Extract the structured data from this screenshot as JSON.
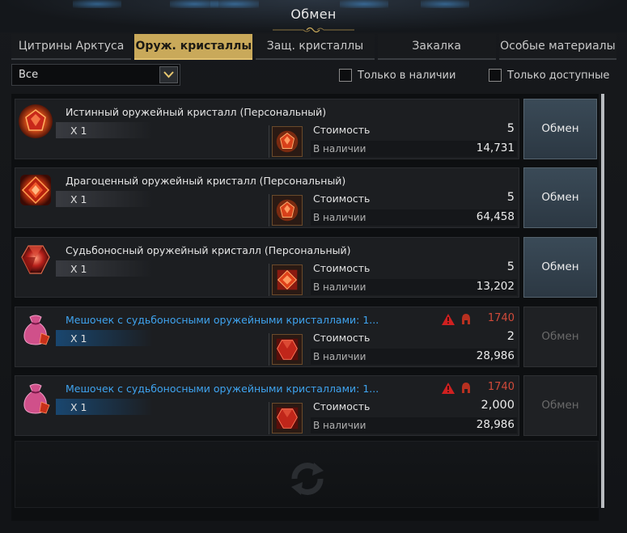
{
  "window": {
    "title": "Обмен"
  },
  "tabs": [
    {
      "label": "Цитрины Арктуса",
      "active": false
    },
    {
      "label": "Оруж. кристаллы",
      "active": true
    },
    {
      "label": "Защ. кристаллы",
      "active": false
    },
    {
      "label": "Закалка",
      "active": false
    },
    {
      "label": "Особые материалы",
      "active": false
    }
  ],
  "filters": {
    "category_value": "Все",
    "only_in_stock_label": "Только в наличии",
    "only_in_stock_checked": false,
    "only_available_label": "Только доступные",
    "only_available_checked": false
  },
  "labels": {
    "cost": "Стоимость",
    "in_stock": "В наличии",
    "exchange_button": "Обмен"
  },
  "items": [
    {
      "name": "Истинный оружейный кристалл (Персональный)",
      "quantity": "X 1",
      "cost": "5",
      "in_stock": "14,731",
      "icon": "true-weapon-crystal-icon",
      "cost_icon": "crystal-cost-icon",
      "is_bag": false,
      "level": "",
      "exchange_enabled": true
    },
    {
      "name": "Драгоценный оружейный кристалл (Персональный)",
      "quantity": "X 1",
      "cost": "5",
      "in_stock": "64,458",
      "icon": "precious-weapon-crystal-icon",
      "cost_icon": "crystal-cost-icon",
      "is_bag": false,
      "level": "",
      "exchange_enabled": true
    },
    {
      "name": "Судьбоносный оружейный кристалл (Персональный)",
      "quantity": "X 1",
      "cost": "5",
      "in_stock": "13,202",
      "icon": "fateful-weapon-crystal-icon",
      "cost_icon": "crystal-cost-icon",
      "is_bag": false,
      "level": "",
      "exchange_enabled": true
    },
    {
      "name": "Мешочек с судьбоносными оружейными кристаллами: 1...",
      "quantity": "X 1",
      "cost": "2",
      "in_stock": "28,986",
      "icon": "crystal-pouch-icon",
      "cost_icon": "red-crystal-cost-icon",
      "is_bag": true,
      "level": "1740",
      "exchange_enabled": false
    },
    {
      "name": "Мешочек с судьбоносными оружейными кристаллами: 1...",
      "quantity": "X 1",
      "cost": "2,000",
      "in_stock": "28,986",
      "icon": "crystal-pouch-icon",
      "cost_icon": "red-crystal-cost-icon",
      "is_bag": true,
      "level": "1740",
      "exchange_enabled": false
    }
  ],
  "colors": {
    "accent_gold": "#c9a95a",
    "link_blue": "#3fa4f0",
    "level_red": "#d04a3a",
    "button_active": "#3a4a57"
  }
}
